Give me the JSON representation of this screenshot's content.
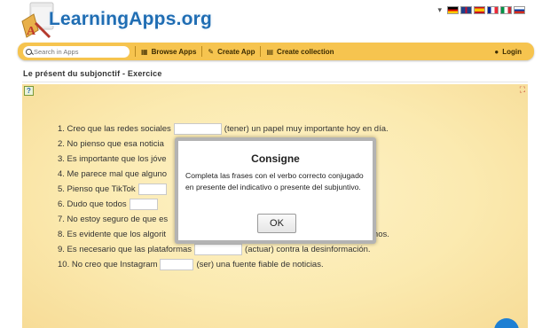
{
  "header": {
    "logo_text": "LearningApps.org",
    "language_caret": "▾",
    "flags": [
      "de-flag",
      "gb-flag",
      "es-flag",
      "fr-flag",
      "it-flag",
      "ru-flag"
    ]
  },
  "navbar": {
    "search_placeholder": "Search in Apps",
    "browse_label": "Browse Apps",
    "create_app_label": "Create App",
    "create_collection_label": "Create collection",
    "login_label": "Login",
    "color": "#f6c44f"
  },
  "page": {
    "title": "Le présent du subjonctif - Exercice"
  },
  "exercise": {
    "items": [
      {
        "before": "1. Creo que las redes sociales",
        "after": "(tener) un papel muy importante hoy en día."
      },
      {
        "before": "2. No pienso que esa noticia",
        "after": ""
      },
      {
        "before": "3. Es importante que los jóve",
        "after": ""
      },
      {
        "before": "4. Me parece mal que alguno",
        "after": "a."
      },
      {
        "before": "5. Pienso que TikTok",
        "after": ""
      },
      {
        "before": "6. Dudo que todos",
        "after": ""
      },
      {
        "before": "7. No estoy seguro de que es",
        "after": ""
      },
      {
        "before": "8. Es evidente que los algorit",
        "after": "emos."
      },
      {
        "before": "9. Es necesario que las plataformas",
        "after": "(actuar) contra la desinformación."
      },
      {
        "before": "10. No creo que Instagram",
        "after": "(ser) una fuente fiable de noticias."
      }
    ]
  },
  "modal": {
    "title": "Consigne",
    "body": "Completa las frases con el verbo correcto conjugado en presente del indicativo o presente del subjuntivo.",
    "ok_label": "OK"
  }
}
